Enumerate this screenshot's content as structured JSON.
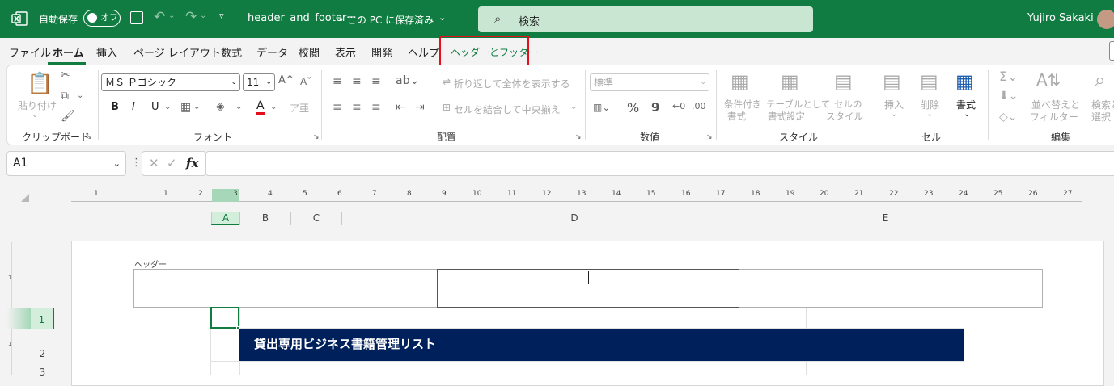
{
  "titlebar": {
    "autosave_label": "自動保存",
    "autosave_state": "オフ",
    "doc_title": "header_and_footer···",
    "doc_location": "• この PC に保存済み",
    "search_placeholder": "検索",
    "user_name": "Yujiro Sakaki"
  },
  "tabs": [
    {
      "label": "ファイル"
    },
    {
      "label": "ホーム"
    },
    {
      "label": "挿入"
    },
    {
      "label": "ページ レイアウト"
    },
    {
      "label": "数式"
    },
    {
      "label": "データ"
    },
    {
      "label": "校閲"
    },
    {
      "label": "表示"
    },
    {
      "label": "開発"
    },
    {
      "label": "ヘルプ"
    },
    {
      "label": "ヘッダーとフッター"
    }
  ],
  "ribbon": {
    "clipboard": {
      "paste": "貼り付け",
      "label": "クリップボード"
    },
    "font": {
      "name": "ＭＳ Ｐゴシック",
      "size": "11",
      "bold": "B",
      "italic": "I",
      "underline": "U",
      "font_color": "A",
      "label": "フォント"
    },
    "alignment": {
      "wrap": "折り返して全体を表示する",
      "merge": "セルを結合して中央揃え",
      "label": "配置"
    },
    "number": {
      "format": "標準",
      "percent": "%",
      "comma": "9",
      "label": "数値"
    },
    "styles": {
      "conditional": "条件付き\n書式",
      "table": "テーブルとして\n書式設定",
      "cell": "セルの\nスタイル",
      "conditional_1": "条件付き",
      "conditional_2": "書式",
      "table_1": "テーブルとして",
      "table_2": "書式設定",
      "cell_1": "セルの",
      "cell_2": "スタイル",
      "label": "スタイル"
    },
    "cells": {
      "insert": "挿入",
      "delete": "削除",
      "format": "書式",
      "label": "セル"
    },
    "editing": {
      "sort_1": "並べ替えと",
      "sort_2": "フィルター",
      "find_1": "検索と",
      "find_2": "選択",
      "label": "編集"
    }
  },
  "formula_bar": {
    "name_box": "A1",
    "fx": "fx",
    "formula": ""
  },
  "ruler": [
    "1",
    "1",
    "2",
    "3",
    "4",
    "5",
    "6",
    "7",
    "8",
    "9",
    "10",
    "11",
    "12",
    "13",
    "14",
    "15",
    "16",
    "17",
    "18",
    "19",
    "20",
    "21",
    "22",
    "23",
    "24",
    "25",
    "26",
    "27"
  ],
  "columns": [
    "A",
    "B",
    "C",
    "D",
    "E"
  ],
  "page": {
    "header_label": "ヘッダー"
  },
  "rows": [
    "1",
    "2",
    "3"
  ],
  "sheet": {
    "A2_title": "貸出専用ビジネス書籍管理リスト"
  },
  "colors": {
    "brand": "#107c41",
    "banner": "#00205b",
    "highlight": "#e3101c"
  }
}
